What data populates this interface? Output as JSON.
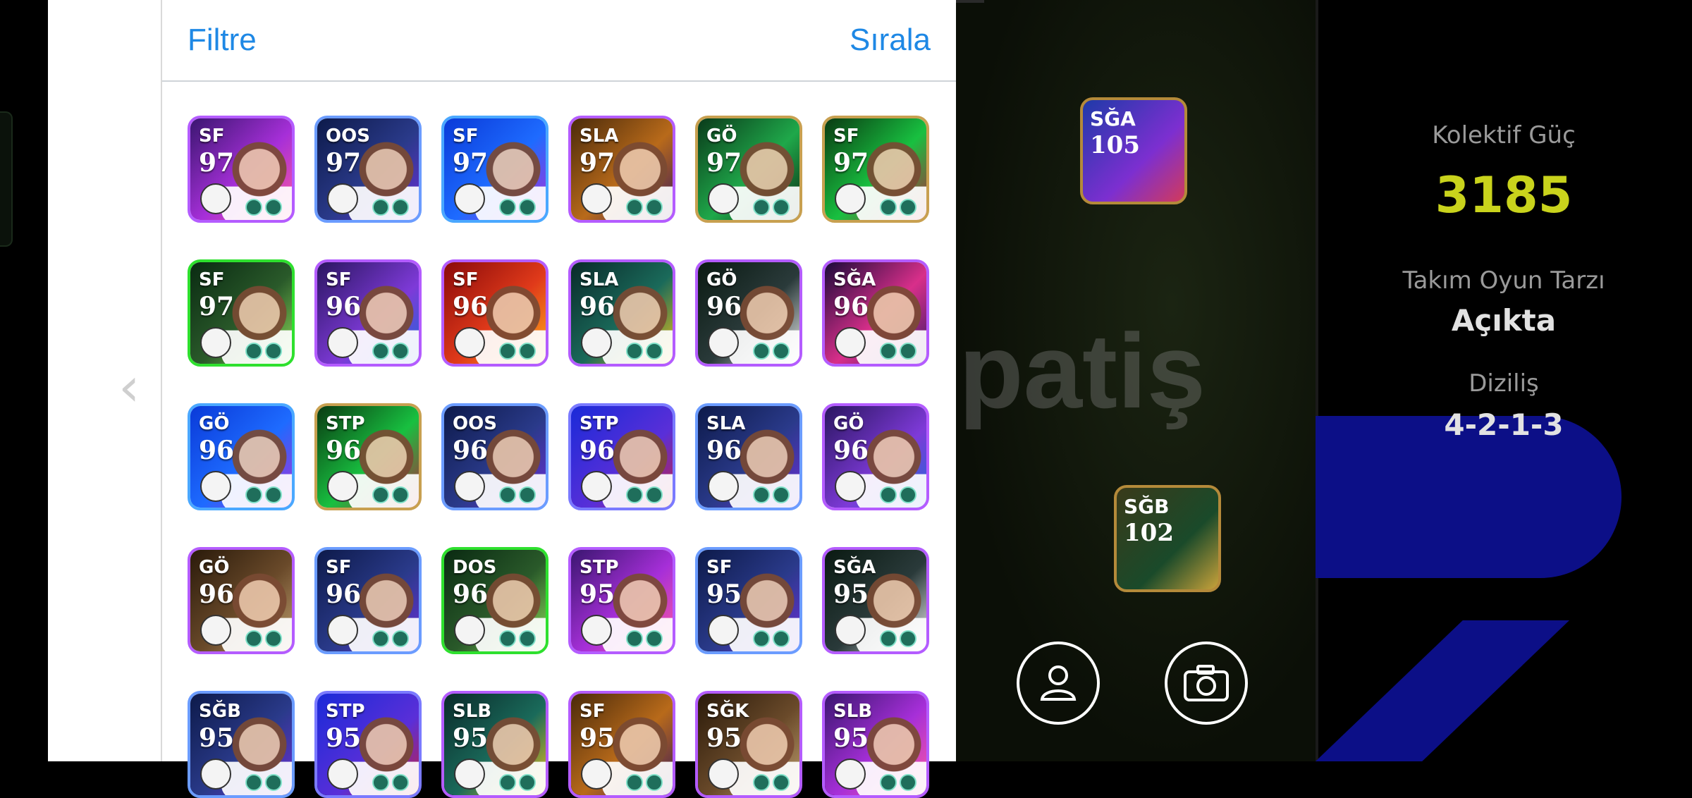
{
  "panel": {
    "filter_label": "Filtre",
    "sort_label": "Sırala"
  },
  "cards": [
    {
      "pos": "SF",
      "rating": "97",
      "style": "purple"
    },
    {
      "pos": "OOS",
      "rating": "97",
      "style": "navy"
    },
    {
      "pos": "SF",
      "rating": "97",
      "style": "blue"
    },
    {
      "pos": "SLA",
      "rating": "97",
      "style": "gold"
    },
    {
      "pos": "GÖ",
      "rating": "97",
      "style": "green"
    },
    {
      "pos": "SF",
      "rating": "97",
      "style": "green2"
    },
    {
      "pos": "SF",
      "rating": "97",
      "style": "lime"
    },
    {
      "pos": "SF",
      "rating": "96",
      "style": "purple2"
    },
    {
      "pos": "SF",
      "rating": "96",
      "style": "red"
    },
    {
      "pos": "SLA",
      "rating": "96",
      "style": "teal"
    },
    {
      "pos": "GÖ",
      "rating": "96",
      "style": "dark"
    },
    {
      "pos": "SĞA",
      "rating": "96",
      "style": "magenta"
    },
    {
      "pos": "GÖ",
      "rating": "96",
      "style": "blue"
    },
    {
      "pos": "STP",
      "rating": "96",
      "style": "green2"
    },
    {
      "pos": "OOS",
      "rating": "96",
      "style": "navy"
    },
    {
      "pos": "STP",
      "rating": "96",
      "style": "blue2"
    },
    {
      "pos": "SLA",
      "rating": "96",
      "style": "navy"
    },
    {
      "pos": "GÖ",
      "rating": "96",
      "style": "purple2"
    },
    {
      "pos": "GÖ",
      "rating": "96",
      "style": "brown"
    },
    {
      "pos": "SF",
      "rating": "96",
      "style": "navy"
    },
    {
      "pos": "DOS",
      "rating": "96",
      "style": "lime"
    },
    {
      "pos": "STP",
      "rating": "95",
      "style": "purple"
    },
    {
      "pos": "SF",
      "rating": "95",
      "style": "navy"
    },
    {
      "pos": "SĞA",
      "rating": "95",
      "style": "dark"
    },
    {
      "pos": "SĞB",
      "rating": "95",
      "style": "navy"
    },
    {
      "pos": "STP",
      "rating": "95",
      "style": "blue2"
    },
    {
      "pos": "SLB",
      "rating": "95",
      "style": "teal"
    },
    {
      "pos": "SF",
      "rating": "95",
      "style": "gold"
    },
    {
      "pos": "SĞK",
      "rating": "95",
      "style": "brown"
    },
    {
      "pos": "SLB",
      "rating": "95",
      "style": "purple"
    }
  ],
  "pitch": {
    "card1": {
      "pos": "SĞA",
      "rating": "105"
    },
    "card2": {
      "pos": "SĞB",
      "rating": "102"
    },
    "watermark": "patiş"
  },
  "info": {
    "collective_label": "Kolektif Güç",
    "collective_value": "3185",
    "style_label": "Takım Oyun Tarzı",
    "style_value": "Açıkta",
    "formation_label": "Diziliş",
    "formation_value": "4-2-1-3"
  },
  "colors": {
    "accent_blue": "#1e88e5",
    "power_yellow": "#c9d31c"
  }
}
